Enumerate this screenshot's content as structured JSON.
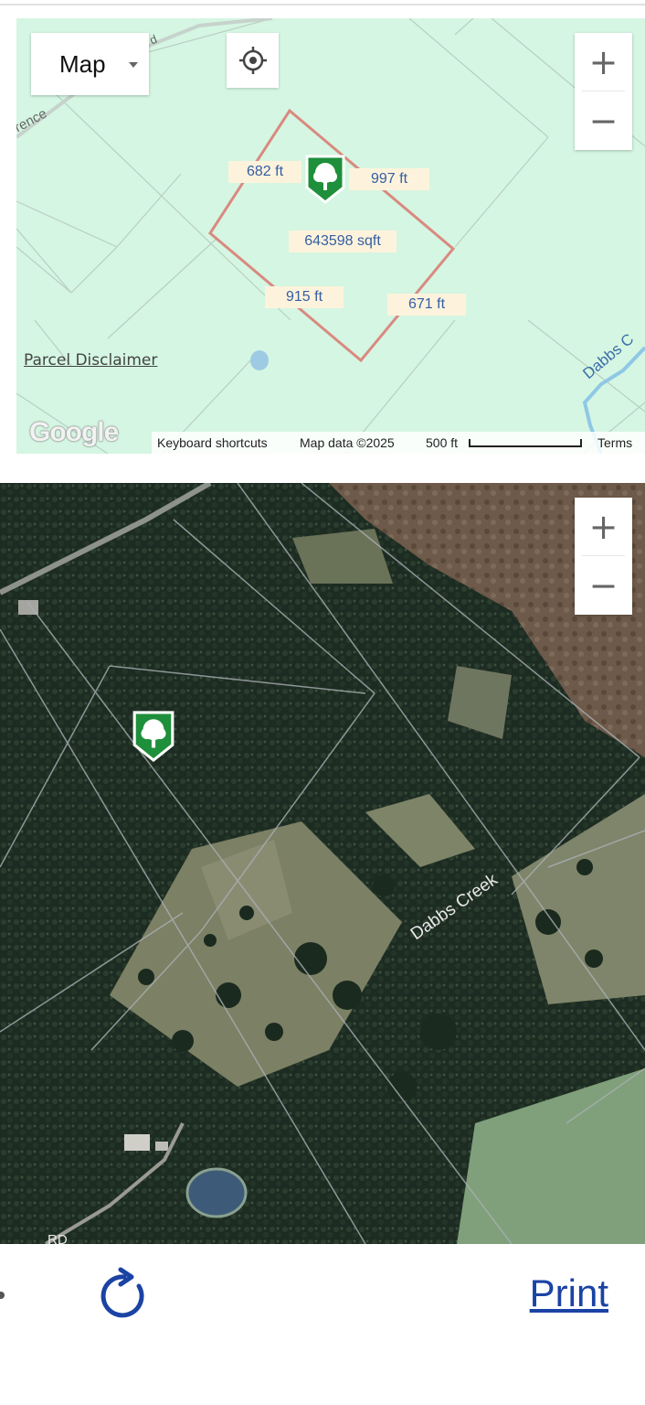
{
  "colors": {
    "map_bg": "#d5f6e2",
    "parcel_outline": "#d98a80",
    "dimension_label_bg": "#fdf3dc",
    "dimension_label_text": "#355ea3",
    "pin_green": "#1e8f3a",
    "print_link": "#1b43a4"
  },
  "map_view": {
    "map_type_label": "Map",
    "road_label": "rence",
    "road_label_tail": "d",
    "creek_label": "Dabbs C",
    "disclaimer": "Parcel Disclaimer",
    "parcel_dimensions": {
      "edge_nw": "682 ft",
      "edge_ne": "997 ft",
      "area": "643598 sqft",
      "edge_sw": "915 ft",
      "edge_se": "671 ft"
    },
    "attribution": {
      "logo": "Google",
      "keyboard_shortcuts": "Keyboard shortcuts",
      "map_data": "Map data ©2025",
      "scale": "500 ft",
      "terms": "Terms"
    },
    "zoom_in_label": "+",
    "zoom_out_label": "−",
    "icons": [
      "locate-icon",
      "tree-pin-icon"
    ]
  },
  "satellite_view": {
    "creek_label": "Dabbs Creek",
    "road_label": "RD",
    "zoom_in_label": "+",
    "zoom_out_label": "−",
    "icons": [
      "tree-pin-icon"
    ]
  },
  "bottom_bar": {
    "print_label": "Print",
    "icons": [
      "refresh-icon"
    ]
  }
}
